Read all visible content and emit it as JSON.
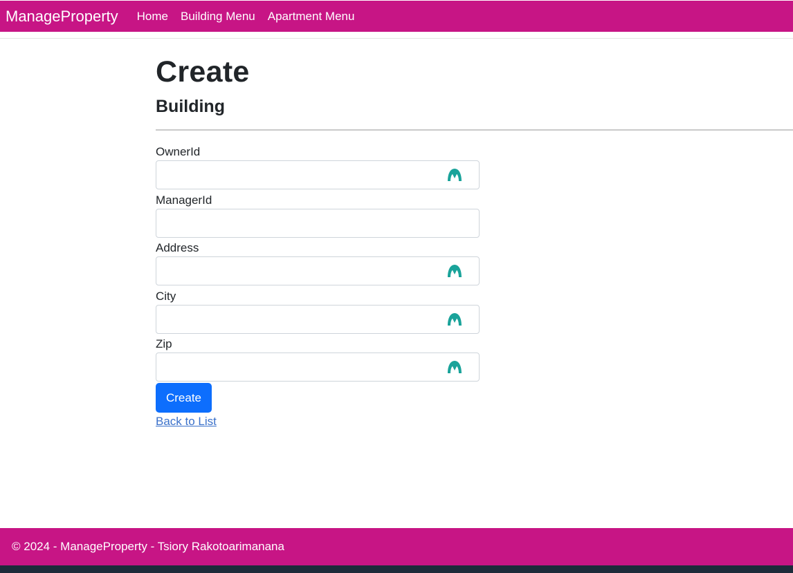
{
  "navbar": {
    "brand": "ManageProperty",
    "links": [
      "Home",
      "Building Menu",
      "Apartment Menu"
    ],
    "color": "#c71585"
  },
  "page": {
    "title": "Create",
    "subtitle": "Building"
  },
  "form": {
    "fields": [
      {
        "label": "OwnerId",
        "value": ""
      },
      {
        "label": "ManagerId",
        "value": ""
      },
      {
        "label": "Address",
        "value": ""
      },
      {
        "label": "City",
        "value": ""
      },
      {
        "label": "Zip",
        "value": ""
      }
    ],
    "autofill_icon": "password-manager-icon",
    "submit_label": "Create",
    "submit_color": "#0d6efd"
  },
  "back_link": "Back to List",
  "footer": {
    "text": "© 2024 - ManageProperty - Tsiory Rakotoarimanana"
  }
}
